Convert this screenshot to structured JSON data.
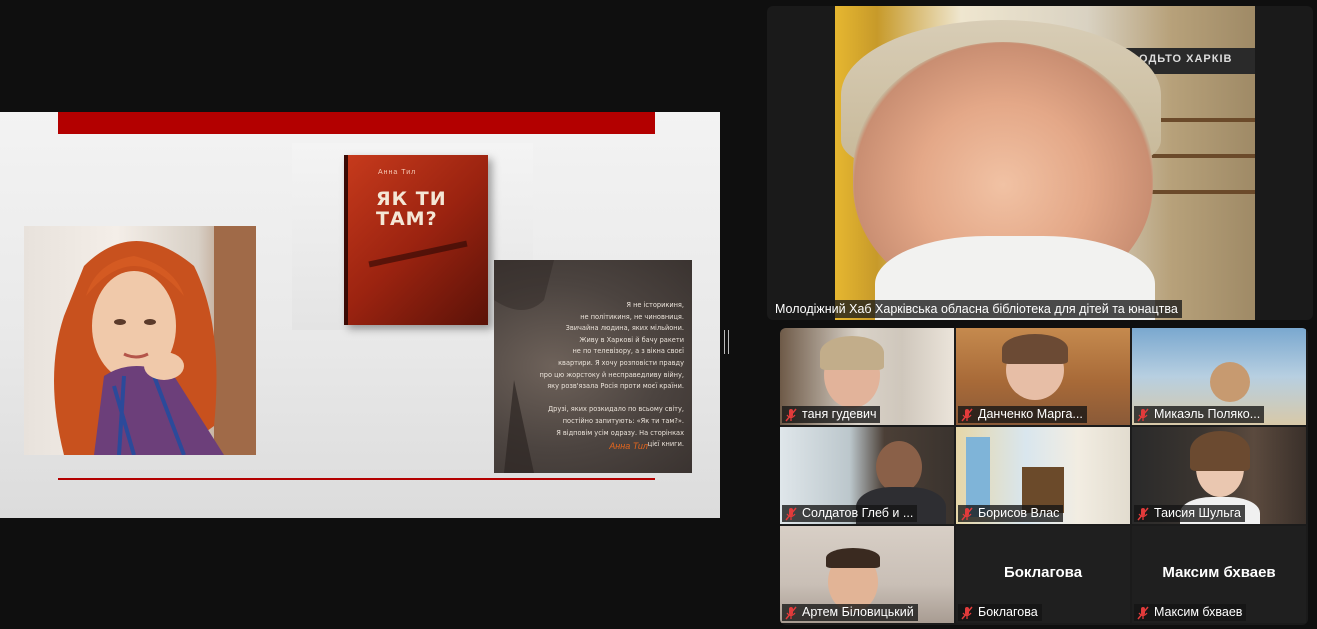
{
  "presentation": {
    "book": {
      "author": "Анна Тил",
      "title": "ЯК ТИ ТАМ?"
    },
    "quote": {
      "text": "Я не історикиня,\nне політикиня, не чиновниця.\nЗвичайна людина, яких мільйони.\nЖиву в Харкові й бачу ракети\nне по телевізору, а з вікна своєї\nквартири. Я хочу розповісти правду\nпро цю жорстоку й несправедливу війну,\nяку розв'язала Росія проти моєї країни.\n\nДрузі, яких розкидало по всьому світу,\nпостійно запитують: «Як ти там?».\nЯ відповім усім одразу. На сторінках\nцієї книги.",
      "signature": "Анна Тил"
    }
  },
  "speaker": {
    "name": "Молодіжний Хаб Харківська обласна бібліотека для дітей та юнацтва",
    "banner": "ХОСТ ОДЬТО ХАРКІВ"
  },
  "participants": [
    {
      "name": "таня гудевич",
      "muted": true
    },
    {
      "name": "Данченко Марга...",
      "muted": true
    },
    {
      "name": "Микаэль Поляко...",
      "muted": true
    },
    {
      "name": "Солдатов Глеб и ...",
      "muted": true
    },
    {
      "name": "Борисов Влас",
      "muted": true
    },
    {
      "name": "Таисия Шульга",
      "muted": true
    },
    {
      "name": "Артем Біловицький",
      "muted": true
    },
    {
      "name": "Боклагова",
      "muted": true,
      "display_name": "Боклагова",
      "video": false
    },
    {
      "name": "Максим бхваев",
      "muted": true,
      "display_name": "Максим бхваев",
      "video": false
    }
  ],
  "colors": {
    "accent_red": "#b30000",
    "muted_icon": "#e23b3b",
    "background": "#0f0f0f"
  },
  "icons": {
    "muted": "microphone-muted-icon"
  }
}
